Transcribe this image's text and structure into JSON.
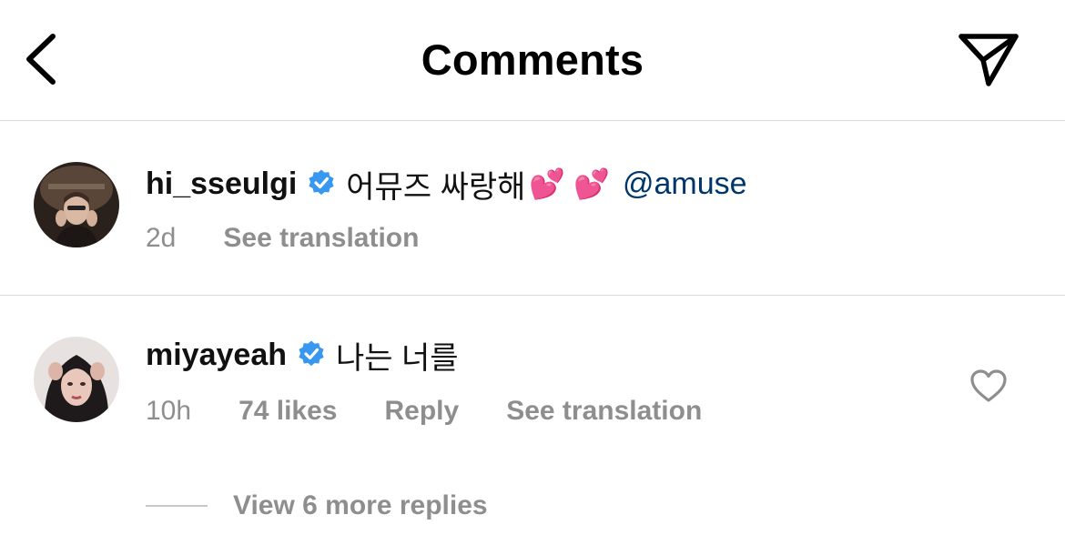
{
  "header": {
    "title": "Comments",
    "back_icon": "chevron-left-icon",
    "share_icon": "paper-plane-icon"
  },
  "comments": [
    {
      "username": "hi_sseulgi",
      "verified": true,
      "text": "어뮤즈 싸랑해",
      "emoji": "💕 💕",
      "mention": "@amuse",
      "time": "2d",
      "see_translation": "See translation"
    },
    {
      "username": "miyayeah",
      "verified": true,
      "text": "나는 너를",
      "time": "10h",
      "likes": "74 likes",
      "reply": "Reply",
      "see_translation": "See translation",
      "view_replies": "View 6 more replies"
    }
  ],
  "colors": {
    "verified": "#3897f0",
    "mention": "#00376b",
    "secondary_text": "#8e8e8e",
    "divider": "#dbdbdb"
  }
}
